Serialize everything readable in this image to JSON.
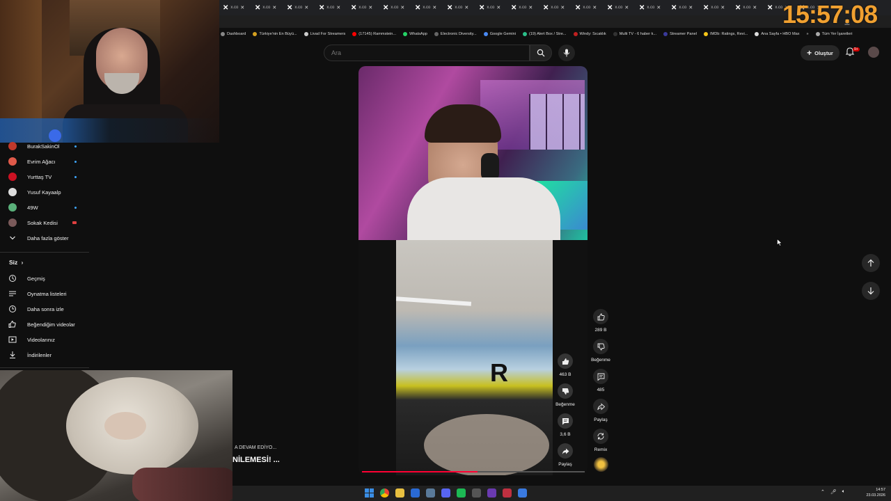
{
  "overlay": {
    "clock": "15:57:08"
  },
  "browser": {
    "tab_label": "x.co",
    "tab_count": 19,
    "bookmarks": [
      {
        "label": "Dashboard",
        "color": "#888888"
      },
      {
        "label": "Türkiye'nin En Büyü...",
        "color": "#d4a020"
      },
      {
        "label": "Livad For Streamers",
        "color": "#cccccc"
      },
      {
        "label": "(17145) Rammstein...",
        "color": "#ff0000"
      },
      {
        "label": "WhatsApp",
        "color": "#25d366"
      },
      {
        "label": "Electronic Diversity...",
        "color": "#666666"
      },
      {
        "label": "Google Gemini",
        "color": "#4a8af4"
      },
      {
        "label": "(19) Alert Box / Stre...",
        "color": "#2bbf8a"
      },
      {
        "label": "Windy: Sıcaklık",
        "color": "#c02020"
      },
      {
        "label": "Multi TV - 6 haber k...",
        "color": "#333333"
      },
      {
        "label": "Streamer Panel",
        "color": "#3a3a9a"
      },
      {
        "label": "IMDb: Ratings, Revi...",
        "color": "#f5c518"
      },
      {
        "label": "Ana Sayfa • HBO Max",
        "color": "#dddddd"
      },
      {
        "label": "»",
        "color": ""
      },
      {
        "label": "Tüm Yer İşaretleri",
        "color": "#aaaaaa"
      }
    ]
  },
  "youtube": {
    "search_placeholder": "Ara",
    "create_label": "Oluştur",
    "notification_badge": "9+"
  },
  "sidebar": {
    "subscriptions": [
      {
        "label": "BurakSakinOl",
        "avatar_color": "#c0392b",
        "live": true
      },
      {
        "label": "Evrim Ağacı",
        "avatar_color": "#e05a4a",
        "live": true
      },
      {
        "label": "Yurttaş TV",
        "avatar_color": "#cc1122",
        "live": true
      },
      {
        "label": "Yusuf Kayaalp",
        "avatar_color": "#dddddd",
        "live": false
      },
      {
        "label": "49W",
        "avatar_color": "#5ab07a",
        "live": true
      },
      {
        "label": "Sokak Kedisi",
        "avatar_color": "#7a5a5a",
        "live": false,
        "live_color": "#e04040"
      }
    ],
    "show_more_label": "Daha fazla göster",
    "you_heading": "Siz",
    "you_items": [
      {
        "label": "Geçmiş",
        "icon": "history-icon"
      },
      {
        "label": "Oynatma listeleri",
        "icon": "playlists-icon"
      },
      {
        "label": "Daha sonra izle",
        "icon": "watch-later-icon"
      },
      {
        "label": "Beğendiğim videolar",
        "icon": "liked-icon"
      },
      {
        "label": "Videolarınız",
        "icon": "your-videos-icon"
      },
      {
        "label": "İndirilenler",
        "icon": "downloads-icon"
      }
    ]
  },
  "short": {
    "progress": 0.52,
    "inner_actions": {
      "likes": "463 B",
      "dislike_label": "Beğenme",
      "comments": "3,6 B",
      "share_label": "Paylaş"
    },
    "actions": {
      "likes": "289 B",
      "dislike_label": "Beğenme",
      "comments": "485",
      "share_label": "Paylaş",
      "remix_label": "Remix"
    }
  },
  "ticker": {
    "line1": "A DEVAM EDİYO...",
    "line2": "NİLEMESİ! ..."
  },
  "taskbar": {
    "time": "14:57",
    "date": "23.03.2026",
    "apps": [
      {
        "icon": "windows-icon",
        "color": "#3a8ee6"
      },
      {
        "icon": "chrome-icon",
        "color": "#e8a030"
      },
      {
        "icon": "folder-icon",
        "color": "#e8c040"
      },
      {
        "icon": "app-blue-icon",
        "color": "#2a6ad4"
      },
      {
        "icon": "steam-icon",
        "color": "#5a7a9a"
      },
      {
        "icon": "discord-icon",
        "color": "#5865f2"
      },
      {
        "icon": "spotify-icon",
        "color": "#1db954"
      },
      {
        "icon": "calculator-icon",
        "color": "#555555"
      },
      {
        "icon": "kick-icon",
        "color": "#6a3ab0"
      },
      {
        "icon": "app-red-icon",
        "color": "#c03040"
      },
      {
        "icon": "app-blue2-icon",
        "color": "#3a7ae0"
      }
    ]
  }
}
